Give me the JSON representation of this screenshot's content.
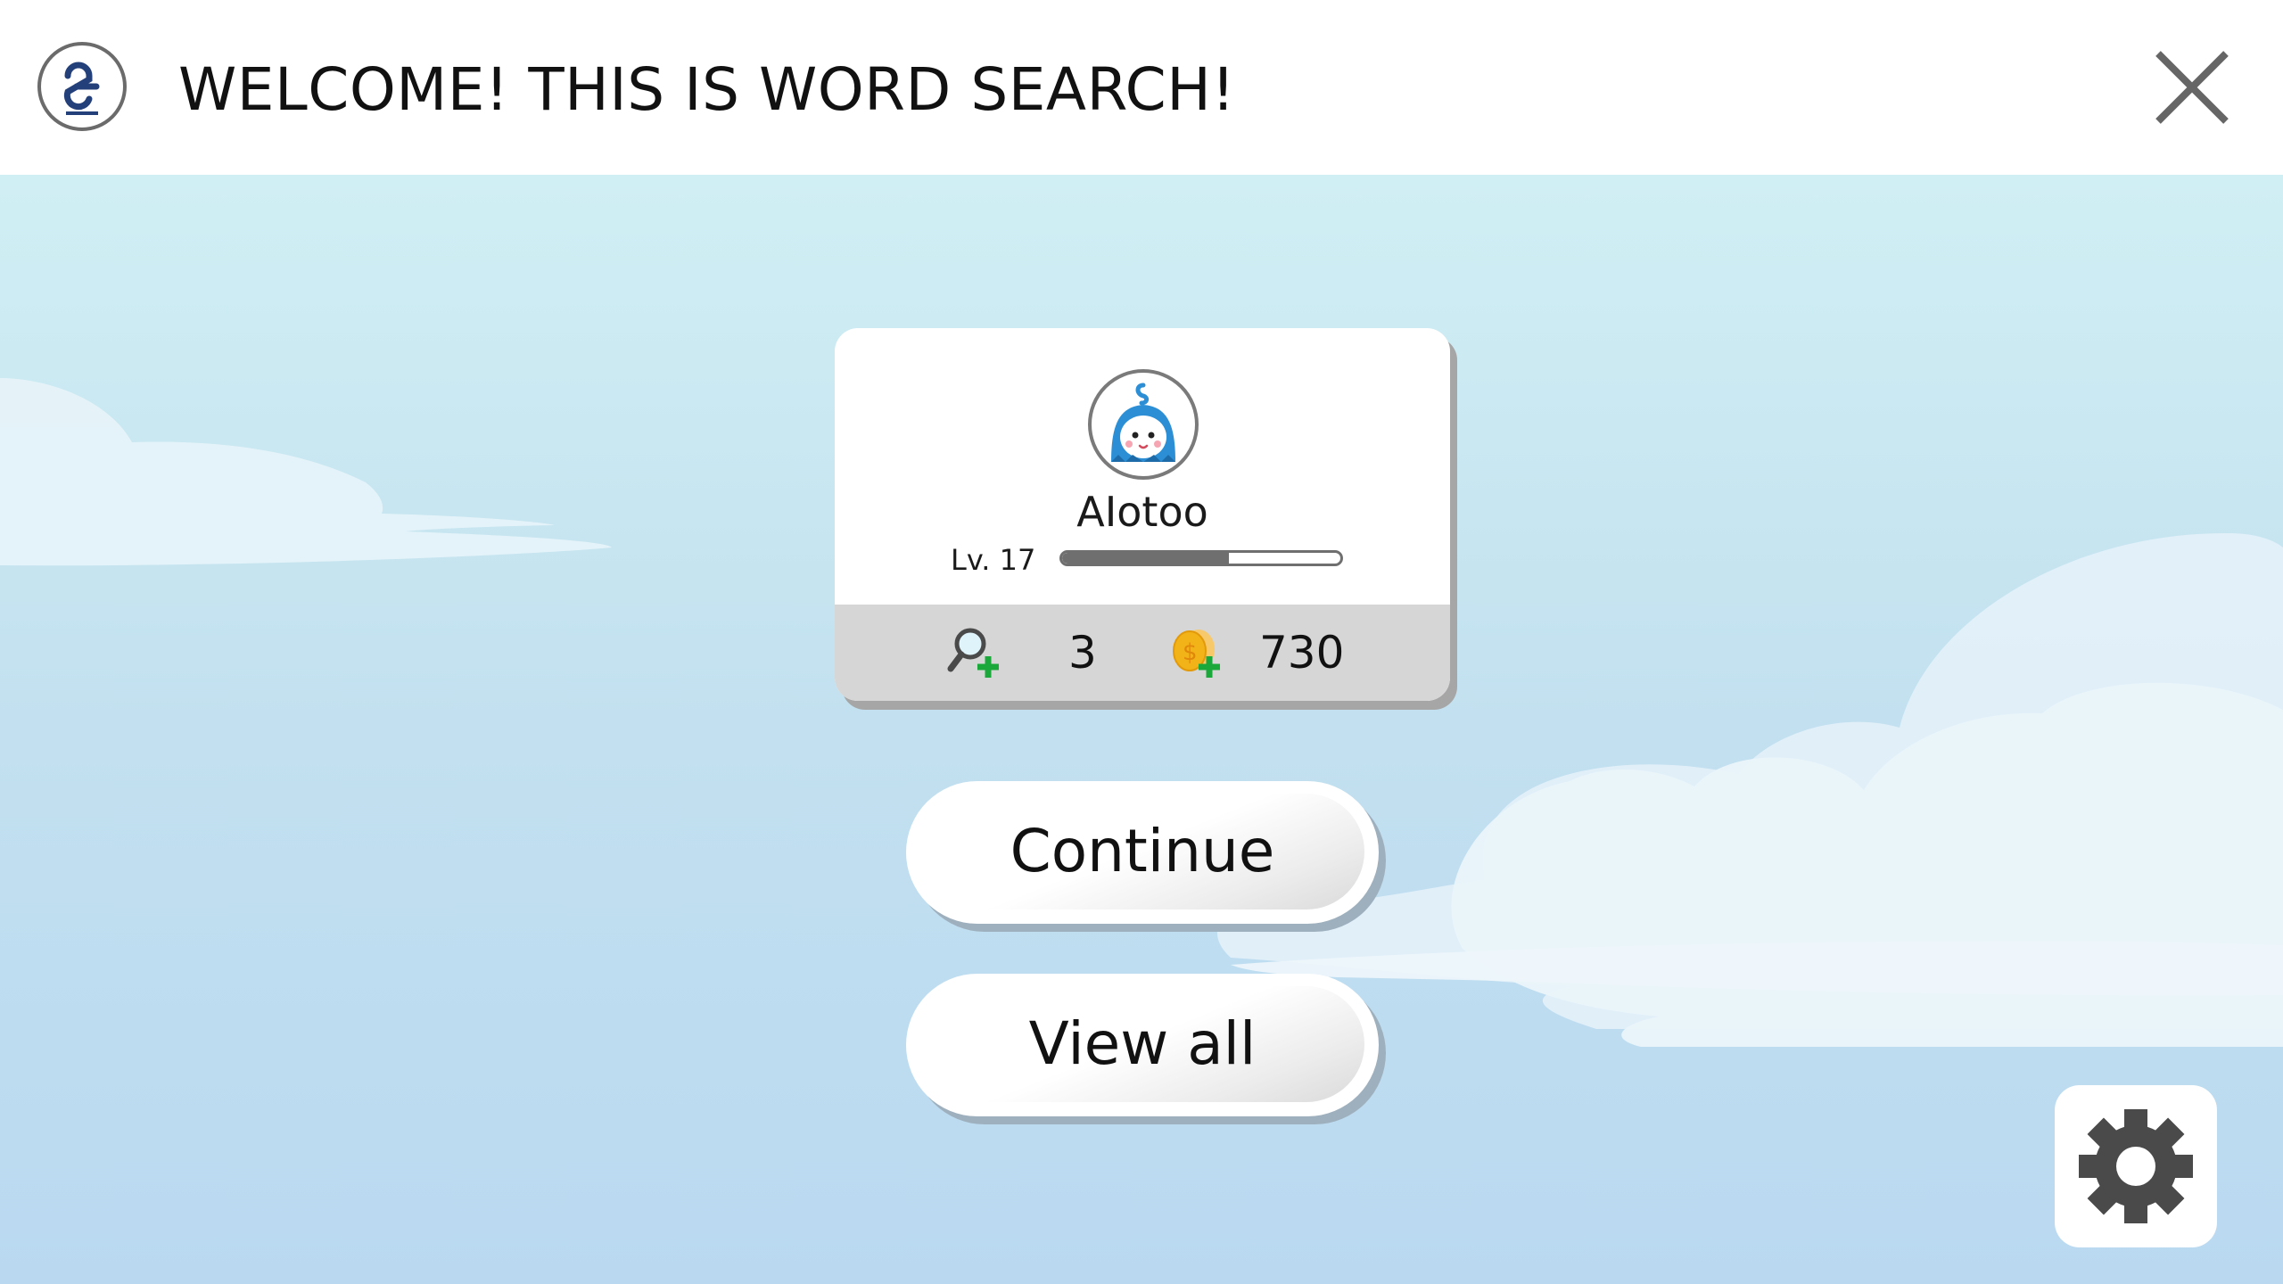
{
  "header": {
    "title": "WELCOME! THIS IS WORD SEARCH!",
    "logo_icon": "o2o-logo-icon",
    "close_icon": "close-icon"
  },
  "profile": {
    "avatar_icon": "avatar-character-icon",
    "username": "AIotoo",
    "level_label": "Lv. 17",
    "xp_progress": 0.6,
    "hints": {
      "icon": "magnifier-plus-icon",
      "count": "3"
    },
    "coins": {
      "icon": "coin-plus-icon",
      "count": "730"
    }
  },
  "buttons": {
    "continue_label": "Continue",
    "view_all_label": "View all"
  },
  "settings": {
    "icon": "gear-icon"
  },
  "colors": {
    "sky_top": "#d0eff4",
    "sky_bottom": "#bad9f1",
    "cloud": "#e8f4fb",
    "card_strip": "#d6d6d6",
    "progress": "#6f6f6f",
    "icon_gray": "#4a4a4a",
    "plus_green": "#1aa83a",
    "coin_gold": "#f2b318",
    "avatar_blue": "#2c8fd6"
  }
}
